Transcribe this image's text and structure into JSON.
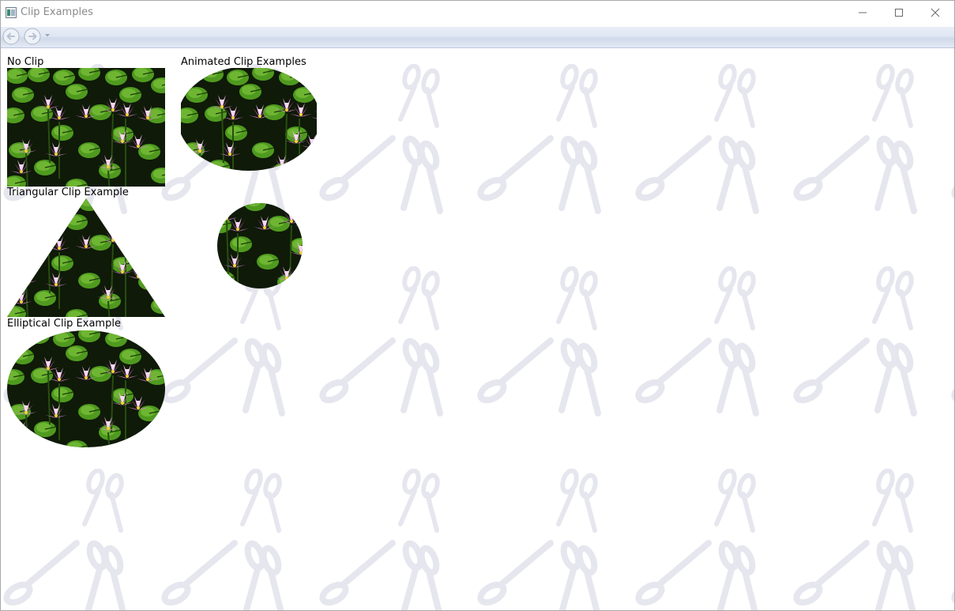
{
  "window": {
    "title": "Clip Examples",
    "accent_bg": "#ffffff",
    "watermark_color": "#e6e6ef"
  },
  "navigation": {
    "back_icon": "back-arrow-icon",
    "forward_icon": "forward-arrow-icon",
    "history_icon": "chevron-down-icon"
  },
  "captions": {
    "minimize_icon": "minimize-icon",
    "maximize_icon": "maximize-icon",
    "close_icon": "close-icon"
  },
  "examples": {
    "no_clip": {
      "label": "No Clip"
    },
    "animated": {
      "label": "Animated Clip Examples"
    },
    "triangular": {
      "label": "Triangular Clip Example"
    },
    "elliptical": {
      "label": "Elliptical Clip Example"
    }
  },
  "image": {
    "subject": "water lilies",
    "colors": {
      "leaf": "#4f9a1f",
      "leaf_light": "#7cc23a",
      "petal": "#d76fc9",
      "petal_light": "#f3b8ee",
      "dark": "#0f1a08"
    }
  }
}
